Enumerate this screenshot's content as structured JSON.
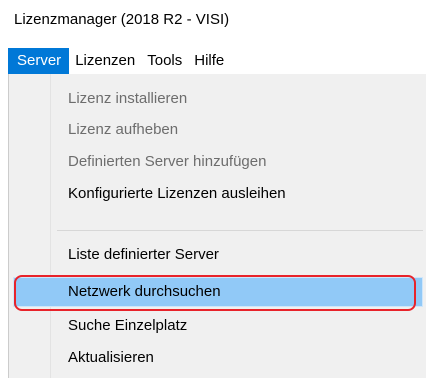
{
  "window": {
    "title": "Lizenzmanager (2018 R2 - VISI)"
  },
  "menubar": {
    "items": [
      {
        "label": "Server",
        "active": true
      },
      {
        "label": "Lizenzen"
      },
      {
        "label": "Tools"
      },
      {
        "label": "Hilfe"
      }
    ]
  },
  "server_menu": {
    "items": [
      {
        "label": "Lizenz installieren",
        "enabled": false
      },
      {
        "label": "Lizenz aufheben",
        "enabled": false
      },
      {
        "label": "Definierten Server hinzufügen",
        "enabled": false
      },
      {
        "label": "Konfigurierte Lizenzen ausleihen",
        "enabled": true
      },
      {
        "label": "Liste definierter Server",
        "enabled": true
      },
      {
        "label": "Netzwerk durchsuchen",
        "enabled": true,
        "highlighted": true
      },
      {
        "label": "Suche Einzelplatz",
        "enabled": true
      },
      {
        "label": "Aktualisieren",
        "enabled": true
      }
    ]
  },
  "colors": {
    "menubar_active": "#0078d7",
    "menu_highlight": "#91c9f7",
    "annotation": "#e8232a",
    "disabled_text": "#6d6d6d"
  }
}
